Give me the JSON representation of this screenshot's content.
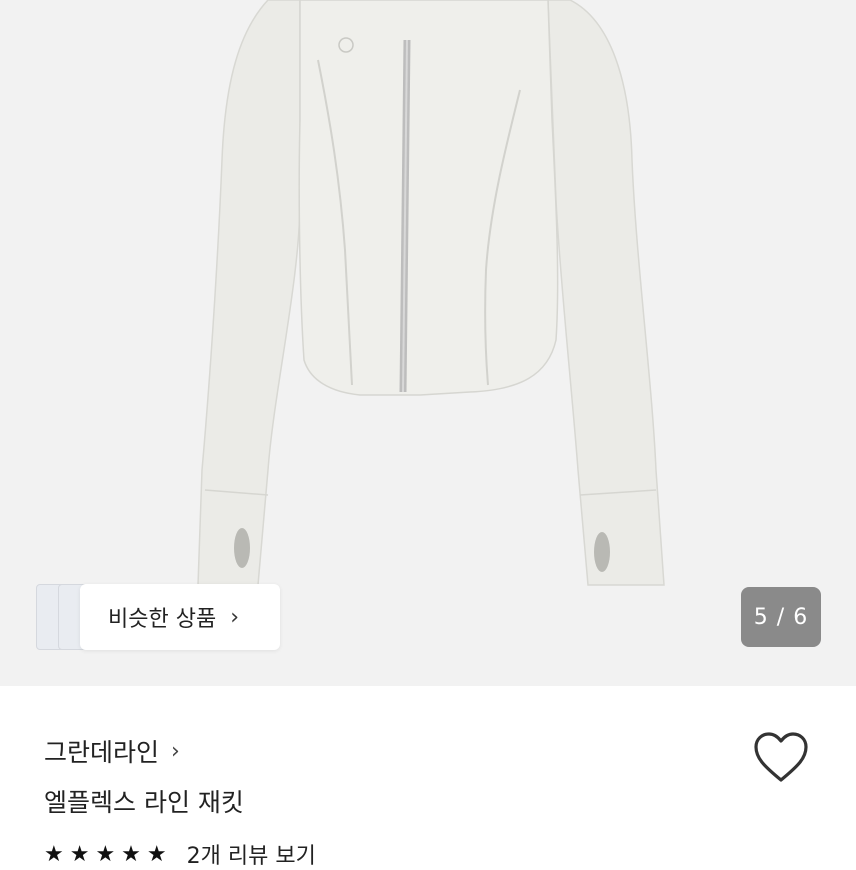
{
  "gallery": {
    "similar_label": "비슷한 상품",
    "chevron_glyph": "›",
    "counter": "5 / 6",
    "current_index": 5,
    "total_images": 6
  },
  "product": {
    "brand": "그란데라인",
    "brand_chevron": "›",
    "name": "엘플렉스 라인 재킷",
    "stars": "★★★★★",
    "rating": 5,
    "review_text": "2개 리뷰 보기"
  },
  "icons": {
    "heart": "heart-outline-icon",
    "chevron": "chevron-right-icon"
  },
  "colors": {
    "hero_background": "#f2f2f2",
    "counter_background": "#7a7a7a",
    "text_primary": "#222222",
    "jacket": "#ecece8"
  }
}
